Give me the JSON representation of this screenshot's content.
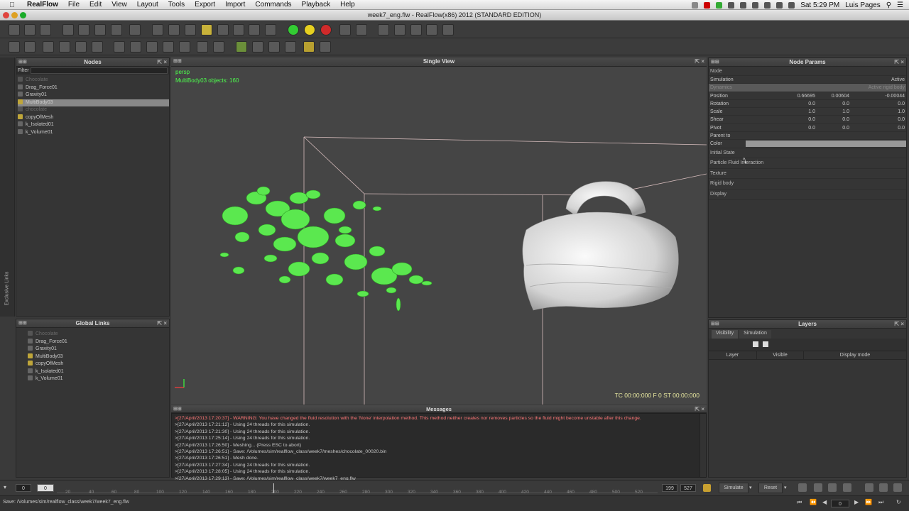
{
  "mac_menu": {
    "app": "RealFlow",
    "items": [
      "File",
      "Edit",
      "View",
      "Layout",
      "Tools",
      "Export",
      "Import",
      "Commands",
      "Playback",
      "Help"
    ],
    "clock": "Sat 5:29 PM",
    "user": "Luis Pages"
  },
  "window": {
    "title": "week7_eng.flw - RealFlow(x86) 2012 (STANDARD EDITION)"
  },
  "nodes_panel": {
    "title": "Nodes",
    "filter_label": "Filter",
    "items": [
      {
        "label": "Chocolate",
        "dim": true
      },
      {
        "label": "Drag_Force01"
      },
      {
        "label": "Gravity01"
      },
      {
        "label": "MultiBody03",
        "selected": true
      },
      {
        "label": "chocolate",
        "dim": true
      },
      {
        "label": "copyOfMesh"
      },
      {
        "label": "k_Isolated01"
      },
      {
        "label": "k_Volume01"
      }
    ]
  },
  "exclusive_links": {
    "label": "Exclusive Links"
  },
  "global_links": {
    "title": "Global Links",
    "items": [
      {
        "label": "Chocolate",
        "dim": true
      },
      {
        "label": "Drag_Force01"
      },
      {
        "label": "Gravity01"
      },
      {
        "label": "MultiBody03"
      },
      {
        "label": "copyOfMesh"
      },
      {
        "label": "k_Isolated01"
      },
      {
        "label": "k_Volume01"
      }
    ]
  },
  "viewport": {
    "title": "Single View",
    "camera": "persp",
    "objects_info": "MultiBody03 objects: 160",
    "timecode": "TC 00:00:000    F 0    ST 00:00:000"
  },
  "node_params": {
    "title": "Node Params",
    "node_label": "Node",
    "rows": [
      {
        "label": "Simulation",
        "v1": "",
        "v2": "",
        "v3": "Active"
      },
      {
        "label": "Dynamics",
        "v1": "",
        "v2": "",
        "v3": "Active rigid body"
      },
      {
        "label": "Position",
        "v1": "0.66695",
        "v2": "0.00604",
        "v3": "-0.00044"
      },
      {
        "label": "Rotation",
        "v1": "0.0",
        "v2": "0.0",
        "v3": "0.0"
      },
      {
        "label": "Scale",
        "v1": "1.0",
        "v2": "1.0",
        "v3": "1.0"
      },
      {
        "label": "Shear",
        "v1": "0.0",
        "v2": "0.0",
        "v3": "0.0"
      },
      {
        "label": "Pivot",
        "v1": "0.0",
        "v2": "0.0",
        "v3": "0.0"
      },
      {
        "label": "Parent to",
        "v1": "",
        "v2": "",
        "v3": ""
      },
      {
        "label": "Color",
        "v1": "",
        "v2": "",
        "v3": ""
      }
    ],
    "sections": [
      "Initial State",
      "Particle Fluid Interaction",
      "Texture",
      "Rigid body",
      "Display"
    ]
  },
  "layers": {
    "title": "Layers",
    "tabs": [
      "Visibility",
      "Simulation"
    ],
    "columns": [
      "Layer",
      "Visible",
      "Display mode"
    ]
  },
  "messages": {
    "title": "Messages",
    "lines": [
      {
        "text": ">[27/April/2013 17:20:37] - WARNING: You have changed the fluid resolution with the 'None' interpolation method. This method neither creates nor removes particles so the fluid might become unstable after this change.",
        "warn": true
      },
      {
        "text": ">[27/April/2013 17:21:12] - Using 24 threads for this simulation."
      },
      {
        "text": ">[27/April/2013 17:21:30] - Using 24 threads for this simulation."
      },
      {
        "text": ">[27/April/2013 17:25:14] - Using 24 threads for this simulation."
      },
      {
        "text": ">[27/April/2013 17:26:50] - Meshing... (Press ESC to abort)"
      },
      {
        "text": ">[27/April/2013 17:26:51] - Save: /Volumes/sim/realflow_class/week7/meshes/chocolate_00020.bin"
      },
      {
        "text": ">[27/April/2013 17:26:51] - Mesh done."
      },
      {
        "text": ">[27/April/2013 17:27:34] - Using 24 threads for this simulation."
      },
      {
        "text": ">[27/April/2013 17:28:05] - Using 24 threads for this simulation."
      },
      {
        "text": ">[27/April/2013 17:29:13] - Save: /Volumes/sim/realflow_class/week7/week7_eng.flw"
      }
    ]
  },
  "timeline": {
    "start": "0",
    "current": "0",
    "ticks": [
      "20",
      "40",
      "60",
      "80",
      "100",
      "120",
      "140",
      "160",
      "180",
      "200",
      "220",
      "240",
      "260",
      "280",
      "300",
      "320",
      "340",
      "360",
      "380",
      "400",
      "420",
      "440",
      "460",
      "480",
      "500",
      "520"
    ],
    "range_a": "199",
    "range_b": "527",
    "simulate_label": "Simulate",
    "reset_label": "Reset",
    "frame": "0"
  },
  "status": {
    "text": "Save: /Volumes/sim/realflow_class/week7/week7_eng.flw"
  }
}
